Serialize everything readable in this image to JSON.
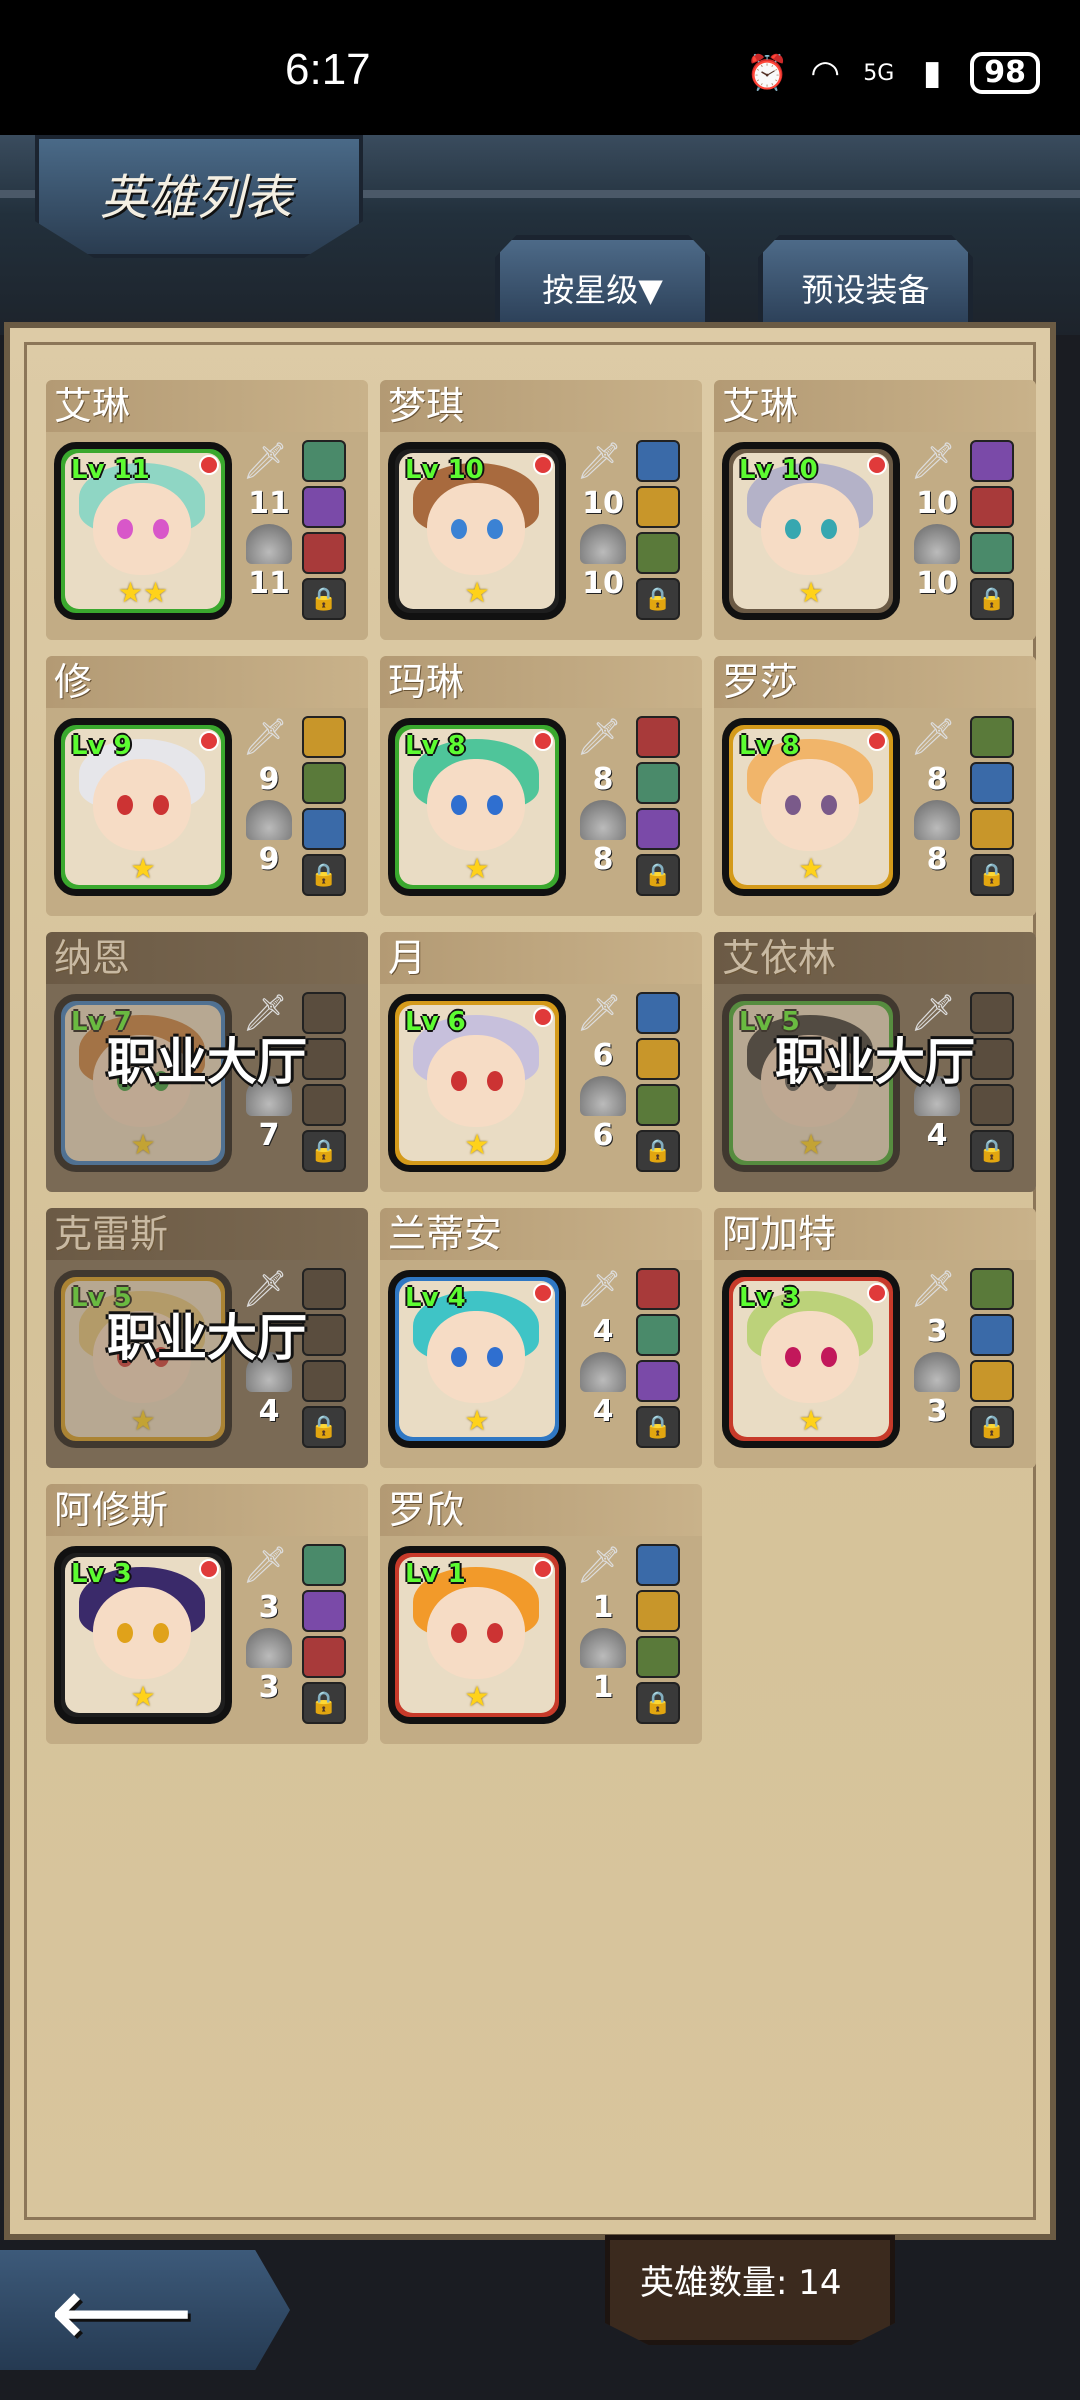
{
  "status_bar": {
    "time": "6:17",
    "network": "5G",
    "battery": "98"
  },
  "header": {
    "title": "英雄列表"
  },
  "tabs": [
    {
      "label": "按星级▼"
    },
    {
      "label": "预设装备"
    }
  ],
  "heroes": [
    {
      "name": "艾琳",
      "level": "Lv 11",
      "stars": "★★",
      "attack": "11",
      "defense": "11",
      "frame": "#3aa82e",
      "hair": "#8fd6c4",
      "eyes": "#d857c9",
      "locked": false
    },
    {
      "name": "梦琪",
      "level": "Lv 10",
      "stars": "★",
      "attack": "10",
      "defense": "10",
      "frame": "#1e1e1e",
      "hair": "#a86a3e",
      "eyes": "#3b82d4",
      "locked": false
    },
    {
      "name": "艾琳",
      "level": "Lv 10",
      "stars": "★",
      "attack": "10",
      "defense": "10",
      "frame": "#6b5a45",
      "hair": "#b4b2c8",
      "eyes": "#37a7b0",
      "locked": false
    },
    {
      "name": "修",
      "level": "Lv 9",
      "stars": "★",
      "attack": "9",
      "defense": "9",
      "frame": "#3aa82e",
      "hair": "#e6e6ea",
      "eyes": "#c33",
      "locked": false
    },
    {
      "name": "玛琳",
      "level": "Lv 8",
      "stars": "★",
      "attack": "8",
      "defense": "8",
      "frame": "#3aa82e",
      "hair": "#4fc59a",
      "eyes": "#2f6fd0",
      "locked": false
    },
    {
      "name": "罗莎",
      "level": "Lv 8",
      "stars": "★",
      "attack": "8",
      "defense": "8",
      "frame": "#d49a1a",
      "hair": "#f1b56a",
      "eyes": "#7a5a8a",
      "locked": false
    },
    {
      "name": "纳恩",
      "level": "Lv 7",
      "stars": "★",
      "attack": "",
      "defense": "7",
      "frame": "#2f78c4",
      "hair": "#c67b3a",
      "eyes": "#2f9a3a",
      "locked": true,
      "overlay": "职业大厅"
    },
    {
      "name": "月",
      "level": "Lv 6",
      "stars": "★",
      "attack": "6",
      "defense": "6",
      "frame": "#d49a1a",
      "hair": "#c7c0dc",
      "eyes": "#c33",
      "locked": false
    },
    {
      "name": "艾依林",
      "level": "Lv 5",
      "stars": "★",
      "attack": "",
      "defense": "4",
      "frame": "#3aa82e",
      "hair": "#333",
      "eyes": "#555",
      "locked": true,
      "overlay": "职业大厅"
    },
    {
      "name": "克雷斯",
      "level": "Lv 5",
      "stars": "★",
      "attack": "",
      "defense": "4",
      "frame": "#d49a1a",
      "hair": "#e2c47a",
      "eyes": "#c33",
      "locked": true,
      "overlay": "职业大厅"
    },
    {
      "name": "兰蒂安",
      "level": "Lv 4",
      "stars": "★",
      "attack": "4",
      "defense": "4",
      "frame": "#2f78c4",
      "hair": "#3fc4c6",
      "eyes": "#2f6fd0",
      "locked": false
    },
    {
      "name": "阿加特",
      "level": "Lv 3",
      "stars": "★",
      "attack": "3",
      "defense": "3",
      "frame": "#c73a2a",
      "hair": "#bcd27a",
      "eyes": "#c2185b",
      "locked": false
    },
    {
      "name": "阿修斯",
      "level": "Lv 3",
      "stars": "★",
      "attack": "3",
      "defense": "3",
      "frame": "#1e1e1e",
      "hair": "#3a2a6a",
      "eyes": "#e0a21a",
      "locked": false
    },
    {
      "name": "罗欣",
      "level": "Lv 1",
      "stars": "★",
      "attack": "1",
      "defense": "1",
      "frame": "#c73a2a",
      "hair": "#f29a2a",
      "eyes": "#c33",
      "locked": false
    }
  ],
  "footer": {
    "hero_count": "英雄数量: 14",
    "back_icon": "back-arrow-icon"
  }
}
